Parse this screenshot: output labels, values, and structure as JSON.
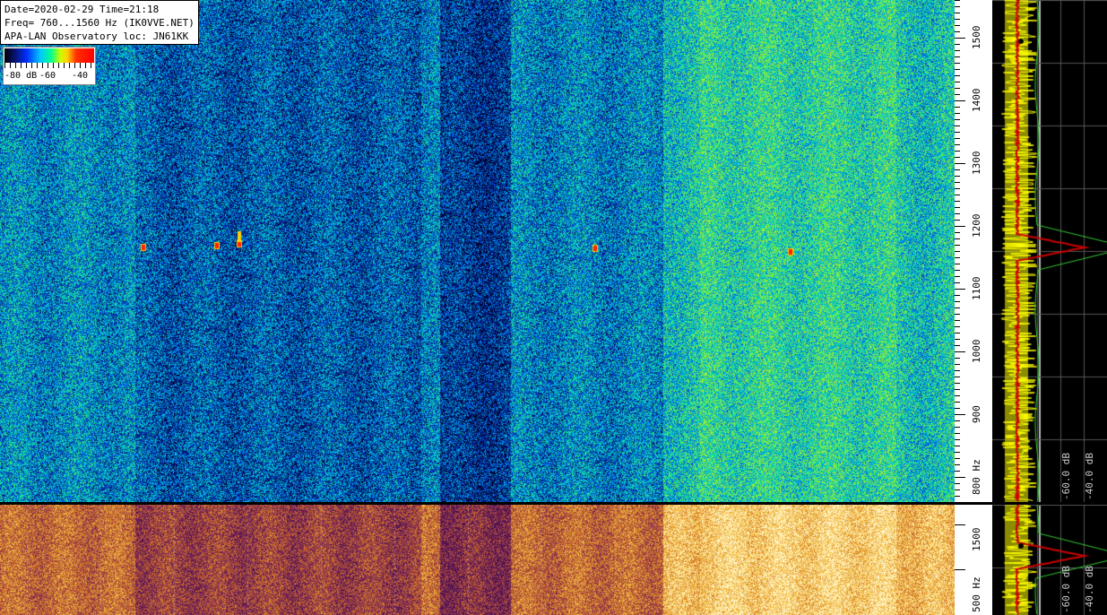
{
  "info": {
    "line1": "Date=2020-02-29 Time=21:18",
    "line2": "Freq= 760...1560 Hz (IK0VVE.NET)",
    "line3": "APA-LAN Observatory loc: JN61KK"
  },
  "legend": {
    "min_label": "-80 dB",
    "mid_label": "-60",
    "max_label": "-40"
  },
  "freq_axis": {
    "labels": [
      "1500",
      "1400",
      "1300",
      "1200",
      "1100",
      "1000",
      "900",
      "800 Hz"
    ],
    "values": [
      1500,
      1400,
      1300,
      1200,
      1100,
      1000,
      900,
      800
    ],
    "range": [
      760,
      1560
    ]
  },
  "freq_axis2": {
    "labels": [
      "1500",
      "500 Hz"
    ]
  },
  "spectrum_scale": {
    "labels": [
      "-60.0 dB",
      "-40.0 dB"
    ]
  },
  "spectrum_scale2": {
    "labels": [
      "-60.0 dB",
      "-40.0 dB"
    ]
  },
  "colors": {
    "spectrum_trace": "#ffff00",
    "peak_trace": "#cc0000",
    "average_trace": "#33cc33"
  }
}
